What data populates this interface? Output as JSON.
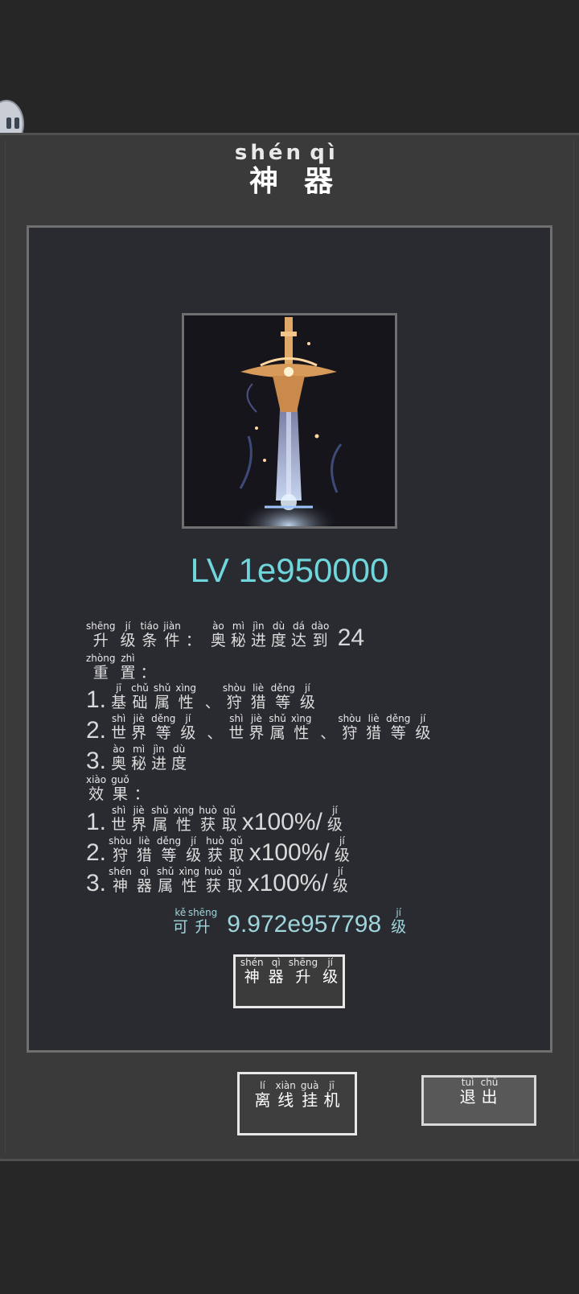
{
  "title": {
    "chars": [
      {
        "han": "神",
        "pinyin": "shén"
      },
      {
        "han": "器",
        "pinyin": "qì"
      }
    ]
  },
  "artifact": {
    "image_icon": "sword-icon"
  },
  "level_text": "LV 1e950000",
  "upgrade_condition": {
    "label": [
      {
        "han": "升",
        "pinyin": "shēng"
      },
      {
        "han": "级",
        "pinyin": "jí"
      },
      {
        "han": "条",
        "pinyin": "tiáo"
      },
      {
        "han": "件",
        "pinyin": "jiàn"
      },
      {
        "han": "：",
        "pinyin": ""
      }
    ],
    "desc": [
      {
        "han": "奥",
        "pinyin": "ào"
      },
      {
        "han": "秘",
        "pinyin": "mì"
      },
      {
        "han": "进",
        "pinyin": "jìn"
      },
      {
        "han": "度",
        "pinyin": "dù"
      },
      {
        "han": "达",
        "pinyin": "dá"
      },
      {
        "han": "到",
        "pinyin": "dào"
      }
    ],
    "value": "24"
  },
  "reset": {
    "label": [
      {
        "han": "重",
        "pinyin": "zhòng"
      },
      {
        "han": "置",
        "pinyin": "zhì"
      },
      {
        "han": "：",
        "pinyin": ""
      }
    ],
    "items": [
      {
        "index": "1.",
        "parts": [
          [
            {
              "han": "基",
              "pinyin": "jī"
            },
            {
              "han": "础",
              "pinyin": "chǔ"
            },
            {
              "han": "属",
              "pinyin": "shǔ"
            },
            {
              "han": "性",
              "pinyin": "xìng"
            }
          ],
          [
            {
              "han": "狩",
              "pinyin": "shòu"
            },
            {
              "han": "猎",
              "pinyin": "liè"
            },
            {
              "han": "等",
              "pinyin": "děng"
            },
            {
              "han": "级",
              "pinyin": "jí"
            }
          ]
        ]
      },
      {
        "index": "2.",
        "parts": [
          [
            {
              "han": "世",
              "pinyin": "shì"
            },
            {
              "han": "界",
              "pinyin": "jiè"
            },
            {
              "han": "等",
              "pinyin": "děng"
            },
            {
              "han": "级",
              "pinyin": "jí"
            }
          ],
          [
            {
              "han": "世",
              "pinyin": "shì"
            },
            {
              "han": "界",
              "pinyin": "jiè"
            },
            {
              "han": "属",
              "pinyin": "shǔ"
            },
            {
              "han": "性",
              "pinyin": "xìng"
            }
          ],
          [
            {
              "han": "狩",
              "pinyin": "shòu"
            },
            {
              "han": "猎",
              "pinyin": "liè"
            },
            {
              "han": "等",
              "pinyin": "děng"
            },
            {
              "han": "级",
              "pinyin": "jí"
            }
          ]
        ]
      },
      {
        "index": "3.",
        "parts": [
          [
            {
              "han": "奥",
              "pinyin": "ào"
            },
            {
              "han": "秘",
              "pinyin": "mì"
            },
            {
              "han": "进",
              "pinyin": "jìn"
            },
            {
              "han": "度",
              "pinyin": "dù"
            }
          ]
        ]
      }
    ],
    "separator": "、"
  },
  "effect": {
    "label": [
      {
        "han": "效",
        "pinyin": "xiào"
      },
      {
        "han": "果",
        "pinyin": "guǒ"
      },
      {
        "han": "：",
        "pinyin": ""
      }
    ],
    "items": [
      {
        "index": "1.",
        "name": [
          {
            "han": "世",
            "pinyin": "shì"
          },
          {
            "han": "界",
            "pinyin": "jiè"
          },
          {
            "han": "属",
            "pinyin": "shǔ"
          },
          {
            "han": "性",
            "pinyin": "xìng"
          },
          {
            "han": "获",
            "pinyin": "huò"
          },
          {
            "han": "取",
            "pinyin": "qǔ"
          }
        ],
        "value": "x100%/",
        "unit": {
          "han": "级",
          "pinyin": "jí"
        }
      },
      {
        "index": "2.",
        "name": [
          {
            "han": "狩",
            "pinyin": "shòu"
          },
          {
            "han": "猎",
            "pinyin": "liè"
          },
          {
            "han": "等",
            "pinyin": "děng"
          },
          {
            "han": "级",
            "pinyin": "jí"
          },
          {
            "han": "获",
            "pinyin": "huò"
          },
          {
            "han": "取",
            "pinyin": "qǔ"
          }
        ],
        "value": "x100%/",
        "unit": {
          "han": "级",
          "pinyin": "jí"
        }
      },
      {
        "index": "3.",
        "name": [
          {
            "han": "神",
            "pinyin": "shén"
          },
          {
            "han": "器",
            "pinyin": "qì"
          },
          {
            "han": "属",
            "pinyin": "shǔ"
          },
          {
            "han": "性",
            "pinyin": "xìng"
          },
          {
            "han": "获",
            "pinyin": "huò"
          },
          {
            "han": "取",
            "pinyin": "qǔ"
          }
        ],
        "value": "x100%/",
        "unit": {
          "han": "级",
          "pinyin": "jí"
        }
      }
    ]
  },
  "upgradable": {
    "prefix": [
      {
        "han": "可",
        "pinyin": "kě"
      },
      {
        "han": "升",
        "pinyin": "shēng"
      }
    ],
    "value": "9.972e957798",
    "suffix": {
      "han": "级",
      "pinyin": "jí"
    }
  },
  "buttons": {
    "artifact_upgrade": [
      {
        "han": "神",
        "pinyin": "shén"
      },
      {
        "han": "器",
        "pinyin": "qì"
      },
      {
        "han": "升",
        "pinyin": "shēng"
      },
      {
        "han": "级",
        "pinyin": "jí"
      }
    ],
    "offline_idle": [
      {
        "han": "离",
        "pinyin": "lí"
      },
      {
        "han": "线",
        "pinyin": "xiàn"
      },
      {
        "han": "挂",
        "pinyin": "guà"
      },
      {
        "han": "机",
        "pinyin": "jī"
      }
    ],
    "exit": [
      {
        "han": "退",
        "pinyin": "tuì"
      },
      {
        "han": "出",
        "pinyin": "chū"
      }
    ]
  },
  "colors": {
    "level": "#6fd6dc",
    "upgradable": "#9fd5dc",
    "panel": "#3a3a3a",
    "inner": "#2a2b30"
  }
}
